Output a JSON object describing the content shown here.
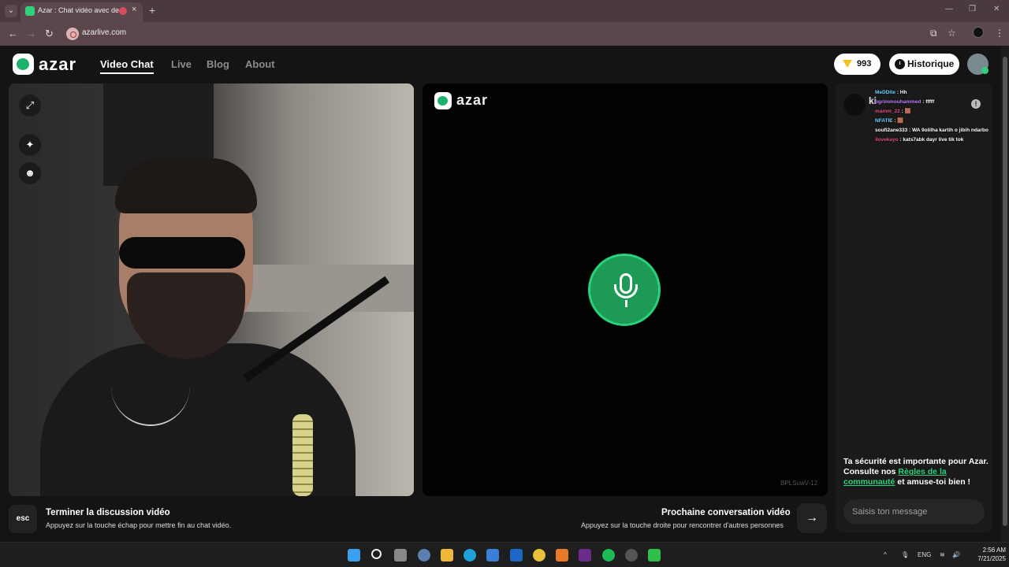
{
  "browser": {
    "tab_title": "Azar : Chat vidéo avec de n",
    "tab_close": "×",
    "new_tab": "+",
    "url": "azarlive.com",
    "minimize": "—",
    "maximize": "❐",
    "close": "✕"
  },
  "header": {
    "logo_text": "azar",
    "nav": [
      "Video Chat",
      "Live",
      "Blog",
      "About"
    ],
    "gems": "993",
    "history_label": "Historique"
  },
  "video": {
    "partner_code": "BPLSuwV-12"
  },
  "chat": {
    "partner_name": "ki",
    "messages": [
      {
        "user": "MeDDite",
        "text": ": Hh",
        "style": "blue"
      },
      {
        "user": "bgrimmouhammed",
        "text": ": fffff",
        "style": "purple"
      },
      {
        "user": "mamm_22",
        "text": ": 🟫",
        "style": "pink"
      },
      {
        "user": "NFATIE",
        "text": ": 🟫",
        "style": "blue"
      },
      {
        "user": "soufi2ane333",
        "text": ": WA 9olilha kartih o jibih ndarbo",
        "style": "white"
      },
      {
        "user": "ilovekayo",
        "text": ": kats7abk dayr live tik tok",
        "style": "pink"
      }
    ],
    "safety_prefix": "Ta sécurité est importante pour Azar. Consulte nos ",
    "safety_link": "Règles de la communauté",
    "safety_suffix": " et amuse-toi bien !",
    "input_placeholder": "Saisis ton message"
  },
  "footer": {
    "esc_key": "esc",
    "end_title": "Terminer la discussion vidéo",
    "end_sub": "Appuyez sur la touche échap pour mettre fin au chat vidéo.",
    "next_title": "Prochaine conversation vidéo",
    "next_sub": "Appuyez sur la touche droite pour rencontrer d'autres personnes",
    "next_arrow": "→"
  },
  "taskbar": {
    "lang": "ENG",
    "time": "2:56 AM",
    "date": "7/21/2025"
  },
  "colors": {
    "brand_green": "#2ad17c",
    "gem_yellow": "#f4c21c"
  }
}
